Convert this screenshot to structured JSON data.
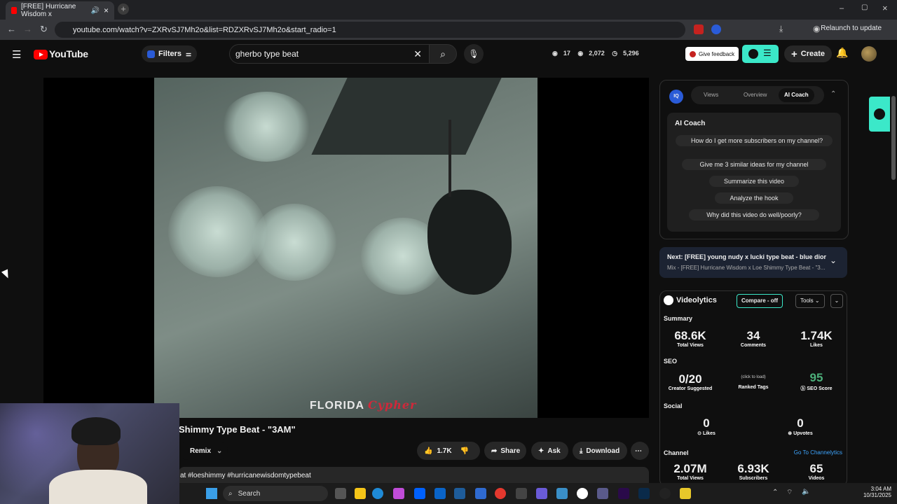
{
  "browser": {
    "tab_title": "[FREE] Hurricane Wisdom x",
    "url": "youtube.com/watch?v=ZXRvSJ7Mh2o&list=RDZXRvSJ7Mh2o&start_radio=1",
    "relaunch_label": "Relaunch to update"
  },
  "header": {
    "logo": "YouTube",
    "filters_label": "Filters",
    "search_value": "gherbo type beat",
    "stats": {
      "a": "17",
      "b": "2,072",
      "c": "5,296"
    },
    "feedback_label": "Give feedback",
    "create_label": "Create"
  },
  "video": {
    "watermark": "FLORIDA",
    "watermark_overlay": "Cypher",
    "title": "Shimmy Type Beat - \"3AM\"",
    "remix_label": "Remix",
    "likes": "1.7K",
    "share_label": "Share",
    "ask_label": "Ask",
    "download_label": "Download",
    "hashtags": "at #loeshimmy #hurricanewisdomtypebeat"
  },
  "coach": {
    "tabs": [
      "Views",
      "Overview",
      "AI Coach"
    ],
    "heading": "AI Coach",
    "prompts": [
      "How do I get more subscribers on my channel?",
      "Give me 3 similar ideas for my channel",
      "Summarize this video",
      "Analyze the hook",
      "Why did this video do well/poorly?"
    ]
  },
  "next": {
    "label": "Next: [FREE] young nudy x lucki type beat - blue dior",
    "sub": "Mix - [FREE] Hurricane Wisdom x Loe Shimmy Type Beat - \"3..."
  },
  "videolytics": {
    "brand": "Videolytics",
    "compare_label": "Compare - off",
    "tools_label": "Tools",
    "summary_heading": "Summary",
    "total_views": "68.6K",
    "total_views_label": "Total Views",
    "comments": "34",
    "comments_label": "Comments",
    "likes": "1.74K",
    "likes_label": "Likes",
    "seo_heading": "SEO",
    "creator_suggested": "0/20",
    "creator_suggested_label": "Creator Suggested",
    "ranked_hint": "(click to load)",
    "ranked_label": "Ranked Tags",
    "seo_score": "95",
    "seo_score_label": "SEO Score",
    "social_heading": "Social",
    "social_likes": "0",
    "social_likes_label": "Likes",
    "upvotes": "0",
    "upvotes_label": "Upvotes",
    "channel_heading": "Channel",
    "channel_link": "Go To Channelytics",
    "ch_views": "2.07M",
    "ch_views_label": "Total Views",
    "ch_subs": "6.93K",
    "ch_subs_label": "Subscribers",
    "ch_videos": "65",
    "ch_videos_label": "Videos",
    "accent": "#3be8c9",
    "seo_color": "#4caf7a"
  },
  "taskbar": {
    "search_label": "Search",
    "time": "3:04 AM",
    "date": "10/31/2025"
  }
}
